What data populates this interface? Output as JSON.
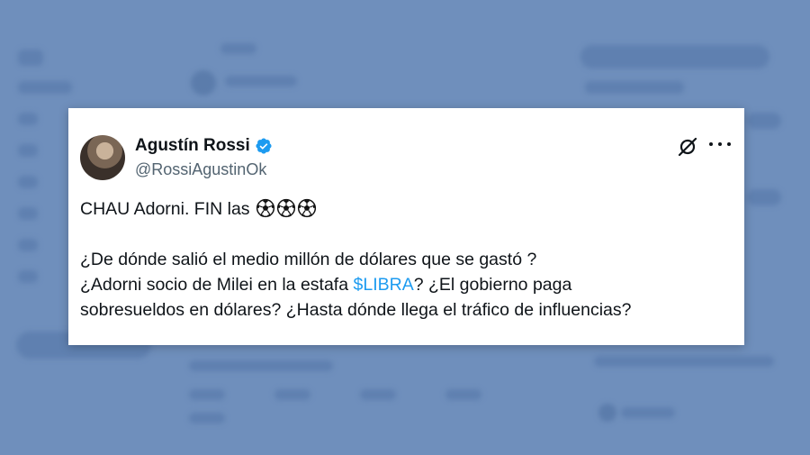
{
  "tweet": {
    "author_name": "Agustín Rossi",
    "handle": "@RossiAgustinOk",
    "verified": true,
    "line1_text": "CHAU Adorni. FIN las ",
    "line1_emoji": [
      "soccer-ball",
      "soccer-ball",
      "soccer-ball"
    ],
    "line2": "¿De dónde salió el medio millón de dólares que se gastó ?",
    "line3_before": "¿Adorni socio de Milei en la estafa ",
    "cashtag": "$LIBRA",
    "line3_after": "? ¿El gobierno paga",
    "line4": "sobresueldos en dólares? ¿Hasta dónde llega el tráfico de influencias?"
  },
  "colors": {
    "background": "#6f8fbc",
    "card": "#ffffff",
    "text": "#0f1419",
    "handle": "#536471",
    "link": "#1d9bf0",
    "verified_badge": "#1d9bf0"
  },
  "icons": [
    "verified-badge-icon",
    "grok-icon",
    "more-icon",
    "soccer-ball-icon"
  ]
}
